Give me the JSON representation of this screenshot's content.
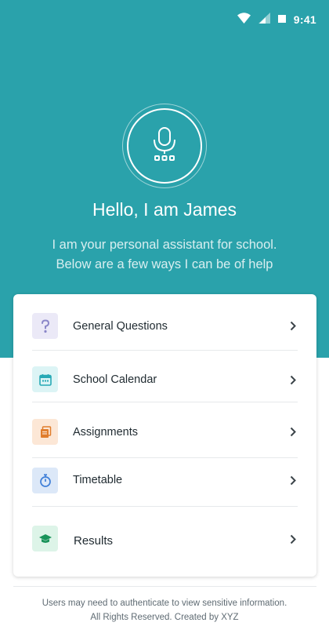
{
  "status_bar": {
    "time": "9:41",
    "icons": [
      "wifi-icon",
      "signal-icon",
      "battery-icon"
    ]
  },
  "header": {
    "mic_icon": "microphone-icon",
    "greeting": "Hello, I am James",
    "subtitle_line1": "I am your personal assistant for school.",
    "subtitle_line2": "Below are a few ways I can be of help"
  },
  "menu": {
    "items": [
      {
        "label": "General Questions",
        "icon": "question-icon",
        "icon_color": "#8a86c8",
        "icon_bg": "#ebe9f7"
      },
      {
        "label": "School Calendar",
        "icon": "calendar-icon",
        "icon_color": "#27a9b5",
        "icon_bg": "#dcf4f5"
      },
      {
        "label": "Assignments",
        "icon": "assignments-icon",
        "icon_color": "#e07d2c",
        "icon_bg": "#fce7d6"
      },
      {
        "label": "Timetable",
        "icon": "stopwatch-icon",
        "icon_color": "#3f7fd8",
        "icon_bg": "#dce8f8"
      },
      {
        "label": "Results",
        "icon": "graduation-cap-icon",
        "icon_color": "#19935a",
        "icon_bg": "#ddf4e8"
      }
    ]
  },
  "footer": {
    "line1": "Users may need to authenticate to view sensitive information.",
    "line2": "All Rights Reserved. Created by XYZ"
  },
  "colors": {
    "brand": "#2aa2ab",
    "text": "#1f2a30"
  }
}
